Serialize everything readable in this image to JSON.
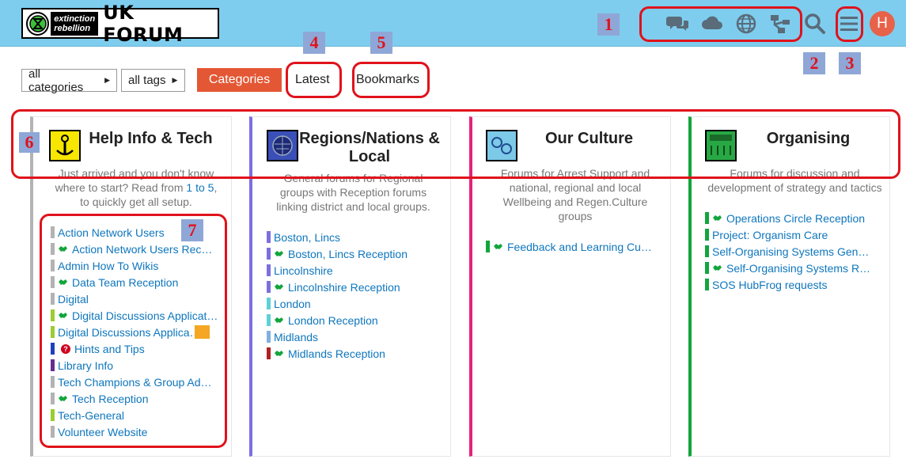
{
  "header": {
    "logo_xr_line1": "extinction",
    "logo_xr_line2": "rebellion",
    "logo_forum_text": "UK FORUM",
    "icons": [
      "chat-icon",
      "cloud-icon",
      "globe-icon",
      "sitemap-icon",
      "search-icon",
      "hamburger-menu-icon"
    ],
    "avatar_letter": "H",
    "background_color": "#7ecdee",
    "avatar_color": "#e8624a"
  },
  "annotations": [
    "1",
    "2",
    "3",
    "4",
    "5",
    "6",
    "7"
  ],
  "nav": {
    "category_filter": "all categories",
    "tag_filter": "all tags",
    "tabs": [
      "Categories",
      "Latest",
      "Bookmarks"
    ],
    "active_tab_color": "#e45735"
  },
  "columns": [
    {
      "title": "Help Info & Tech",
      "color": "#b3b3b3",
      "desc_before": "Just arrived and you don't know where to start? Read from ",
      "desc_link": "1 to 5",
      "desc_after": ", to quickly get all setup.",
      "subcategories": [
        {
          "name": "Action Network Users",
          "color": "#b3b3b3",
          "icon": ""
        },
        {
          "name": "Action Network Users Rec…",
          "color": "#b3b3b3",
          "icon": "handshake-icon"
        },
        {
          "name": "Admin How To Wikis",
          "color": "#b3b3b3",
          "icon": ""
        },
        {
          "name": "Data Team Reception",
          "color": "#b3b3b3",
          "icon": "handshake-icon"
        },
        {
          "name": "Digital",
          "color": "#b3b3b3",
          "icon": ""
        },
        {
          "name": "Digital Discussions Applicat…",
          "color": "#9acd32",
          "icon": "handshake-icon"
        },
        {
          "name": "Digital Discussions Applica…",
          "color": "#9acd32",
          "icon": ""
        },
        {
          "name": "Hints and Tips",
          "color": "#1f3fbf",
          "icon": "question-icon",
          "bar2": "#d0021b"
        },
        {
          "name": "Library Info",
          "color": "#652d90",
          "icon": ""
        },
        {
          "name": "Tech Champions & Group Ad…",
          "color": "#b3b3b3",
          "icon": ""
        },
        {
          "name": "Tech Reception",
          "color": "#b3b3b3",
          "icon": "handshake-icon"
        },
        {
          "name": "Tech-General",
          "color": "#9acd32",
          "icon": ""
        },
        {
          "name": "Volunteer Website",
          "color": "#b3b3b3",
          "icon": ""
        }
      ]
    },
    {
      "title": "Regions/Nations & Local",
      "color": "#7c6fe0",
      "desc": "General forums for Regional groups with Reception forums linking district and local groups.",
      "subcategories": [
        {
          "name": "Boston, Lincs",
          "color": "#7c6fe0",
          "icon": ""
        },
        {
          "name": "Boston, Lincs Reception",
          "color": "#7c6fe0",
          "icon": "handshake-icon"
        },
        {
          "name": "Lincolnshire",
          "color": "#7c6fe0",
          "icon": ""
        },
        {
          "name": "Lincolnshire Reception",
          "color": "#7c6fe0",
          "icon": "handshake-icon"
        },
        {
          "name": "London",
          "color": "#5fd0d8",
          "icon": ""
        },
        {
          "name": "London Reception",
          "color": "#5fd0d8",
          "icon": "handshake-icon"
        },
        {
          "name": "Midlands",
          "color": "#7fb0e0",
          "icon": ""
        },
        {
          "name": "Midlands Reception",
          "color": "#b22020",
          "icon": "handshake-icon"
        }
      ]
    },
    {
      "title": "Our Culture",
      "color": "#e6217a",
      "desc": "Forums for Arrest Support and national, regional and local Wellbeing and Regen.Culture groups",
      "subcategories": [
        {
          "name": "Feedback and Learning Cu…",
          "color": "#12a53c",
          "icon": "handshake-icon"
        }
      ]
    },
    {
      "title": "Organising",
      "color": "#12a53c",
      "desc": "Forums for discussion and development of strategy and tactics",
      "subcategories": [
        {
          "name": "Operations Circle Reception",
          "color": "#12a53c",
          "icon": "handshake-icon"
        },
        {
          "name": "Project: Organism Care",
          "color": "#12a53c",
          "icon": ""
        },
        {
          "name": "Self-Organising Systems Gen…",
          "color": "#12a53c",
          "icon": ""
        },
        {
          "name": "Self-Organising Systems R…",
          "color": "#12a53c",
          "icon": "handshake-icon"
        },
        {
          "name": "SOS HubFrog requests",
          "color": "#12a53c",
          "icon": ""
        }
      ]
    }
  ]
}
